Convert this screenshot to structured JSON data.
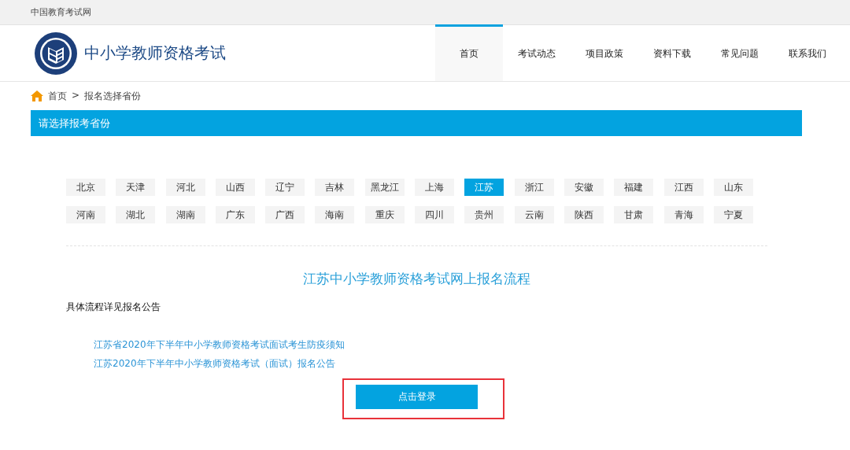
{
  "top_bar": {
    "site_name": "中国教育考试网"
  },
  "header": {
    "title": "中小学教师资格考试"
  },
  "nav": [
    {
      "label": "首页",
      "selected": true
    },
    {
      "label": "考试动态",
      "selected": false
    },
    {
      "label": "项目政策",
      "selected": false
    },
    {
      "label": "资料下载",
      "selected": false
    },
    {
      "label": "常见问题",
      "selected": false
    },
    {
      "label": "联系我们",
      "selected": false
    }
  ],
  "breadcrumb": {
    "separator": ">",
    "items": [
      "首页",
      "报名选择省份"
    ]
  },
  "section_title": "请选择报考省份",
  "provinces": [
    {
      "label": "北京",
      "selected": false
    },
    {
      "label": "天津",
      "selected": false
    },
    {
      "label": "河北",
      "selected": false
    },
    {
      "label": "山西",
      "selected": false
    },
    {
      "label": "辽宁",
      "selected": false
    },
    {
      "label": "吉林",
      "selected": false
    },
    {
      "label": "黑龙江",
      "selected": false
    },
    {
      "label": "上海",
      "selected": false
    },
    {
      "label": "江苏",
      "selected": true
    },
    {
      "label": "浙江",
      "selected": false
    },
    {
      "label": "安徽",
      "selected": false
    },
    {
      "label": "福建",
      "selected": false
    },
    {
      "label": "江西",
      "selected": false
    },
    {
      "label": "山东",
      "selected": false
    },
    {
      "label": "河南",
      "selected": false
    },
    {
      "label": "湖北",
      "selected": false
    },
    {
      "label": "湖南",
      "selected": false
    },
    {
      "label": "广东",
      "selected": false
    },
    {
      "label": "广西",
      "selected": false
    },
    {
      "label": "海南",
      "selected": false
    },
    {
      "label": "重庆",
      "selected": false
    },
    {
      "label": "四川",
      "selected": false
    },
    {
      "label": "贵州",
      "selected": false
    },
    {
      "label": "云南",
      "selected": false
    },
    {
      "label": "陕西",
      "selected": false
    },
    {
      "label": "甘肃",
      "selected": false
    },
    {
      "label": "青海",
      "selected": false
    },
    {
      "label": "宁夏",
      "selected": false
    }
  ],
  "process": {
    "title": "江苏中小学教师资格考试网上报名流程",
    "note": "具体流程详见报名公告",
    "links": [
      "江苏省2020年下半年中小学教师资格考试面试考生防疫须知",
      "江苏2020年下半年中小学教师资格考试（面试）报名公告"
    ],
    "login_button": {
      "label": "点击登录",
      "highlighted": true
    }
  }
}
